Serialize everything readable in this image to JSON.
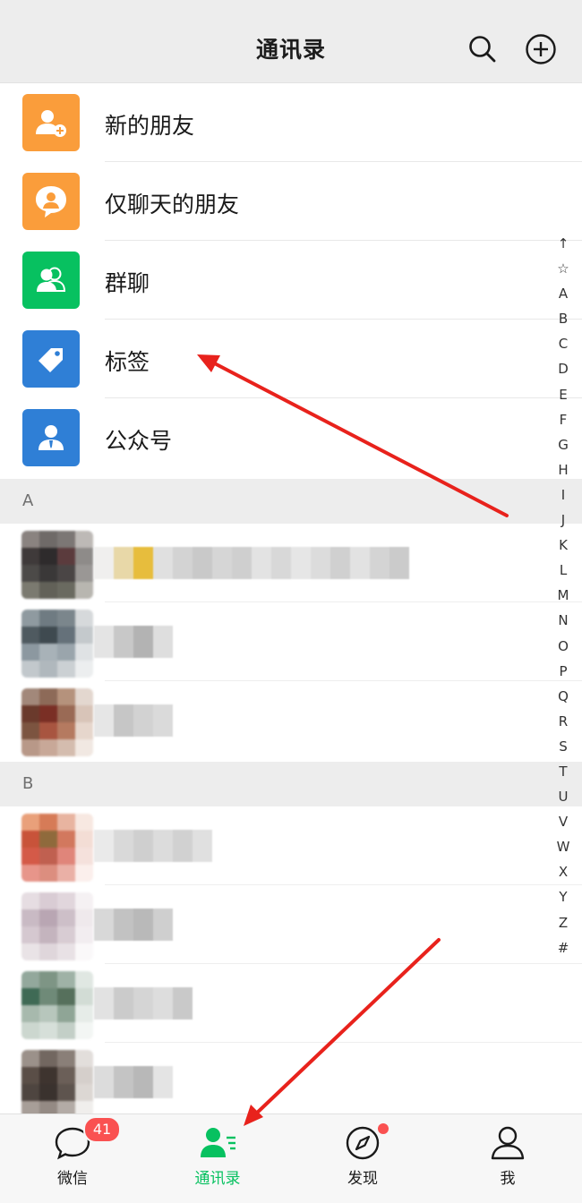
{
  "header": {
    "title": "通讯录",
    "search_icon": "search-icon",
    "add_icon": "plus-circle-icon"
  },
  "fixed_items": [
    {
      "label": "新的朋友",
      "icon": "add-friend-icon",
      "color": "#fa9d3b"
    },
    {
      "label": "仅聊天的朋友",
      "icon": "chat-only-friend-icon",
      "color": "#fa9d3b"
    },
    {
      "label": "群聊",
      "icon": "group-chat-icon",
      "color": "#07c160"
    },
    {
      "label": "标签",
      "icon": "tag-icon",
      "color": "#2f7fd6"
    },
    {
      "label": "公众号",
      "icon": "official-account-icon",
      "color": "#2f7fd6"
    }
  ],
  "sections": [
    {
      "letter": "A"
    },
    {
      "letter": "B"
    }
  ],
  "index_letters": [
    "↑",
    "☆",
    "A",
    "B",
    "C",
    "D",
    "E",
    "F",
    "G",
    "H",
    "I",
    "J",
    "K",
    "L",
    "M",
    "N",
    "O",
    "P",
    "Q",
    "R",
    "S",
    "T",
    "U",
    "V",
    "W",
    "X",
    "Y",
    "Z",
    "#"
  ],
  "tabs": [
    {
      "label": "微信",
      "icon": "chat-bubble-icon",
      "badge": "41"
    },
    {
      "label": "通讯录",
      "icon": "contacts-icon",
      "active": true
    },
    {
      "label": "发现",
      "icon": "compass-icon",
      "dot": true
    },
    {
      "label": "我",
      "icon": "person-icon"
    }
  ],
  "colors": {
    "accent": "#07c160",
    "badge": "#fa5151",
    "annotation_arrow": "#e8221c"
  }
}
